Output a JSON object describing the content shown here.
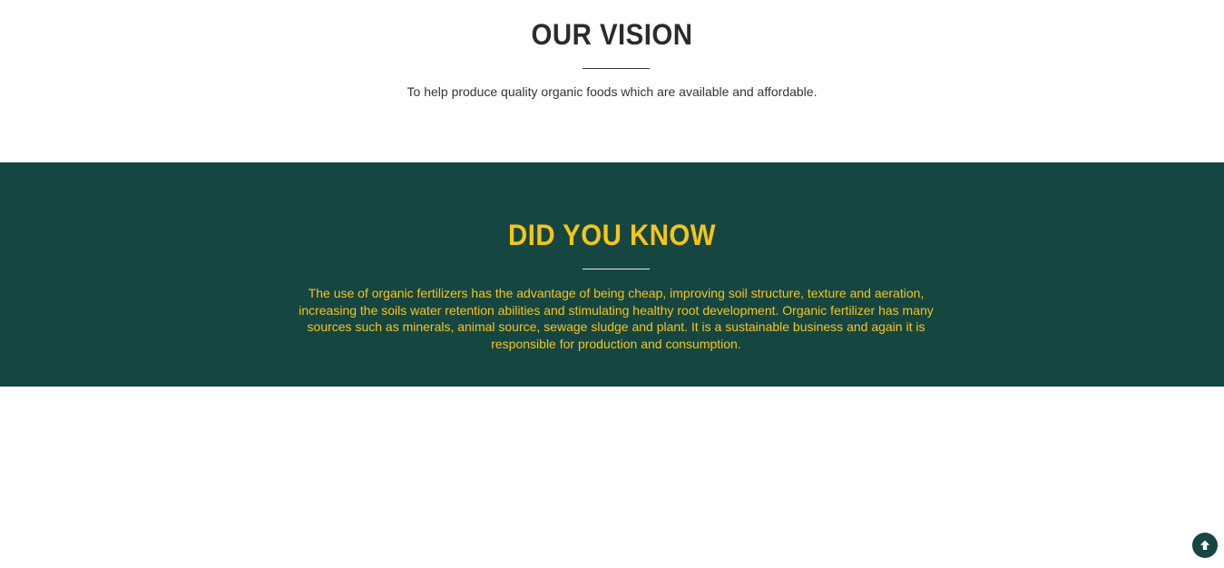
{
  "vision": {
    "title": "OUR VISION",
    "text": "To help produce quality organic foods which are available and affordable."
  },
  "did_you_know": {
    "title": "DID YOU KNOW",
    "text": "The use of organic fertilizers has the advantage of being cheap, improving soil structure, texture and aeration, increasing the soils water retention abilities and stimulating healthy root development. Organic fertilizer has many sources such as minerals, animal source, sewage sludge and plant. It is a sustainable business and again it is responsible for production and consumption."
  },
  "scroll_top": {
    "icon": "arrow-up-circle-icon"
  },
  "colors": {
    "dark_green": "#164642",
    "accent_yellow": "#f5c518",
    "heading_dark": "#2b2b2b"
  }
}
